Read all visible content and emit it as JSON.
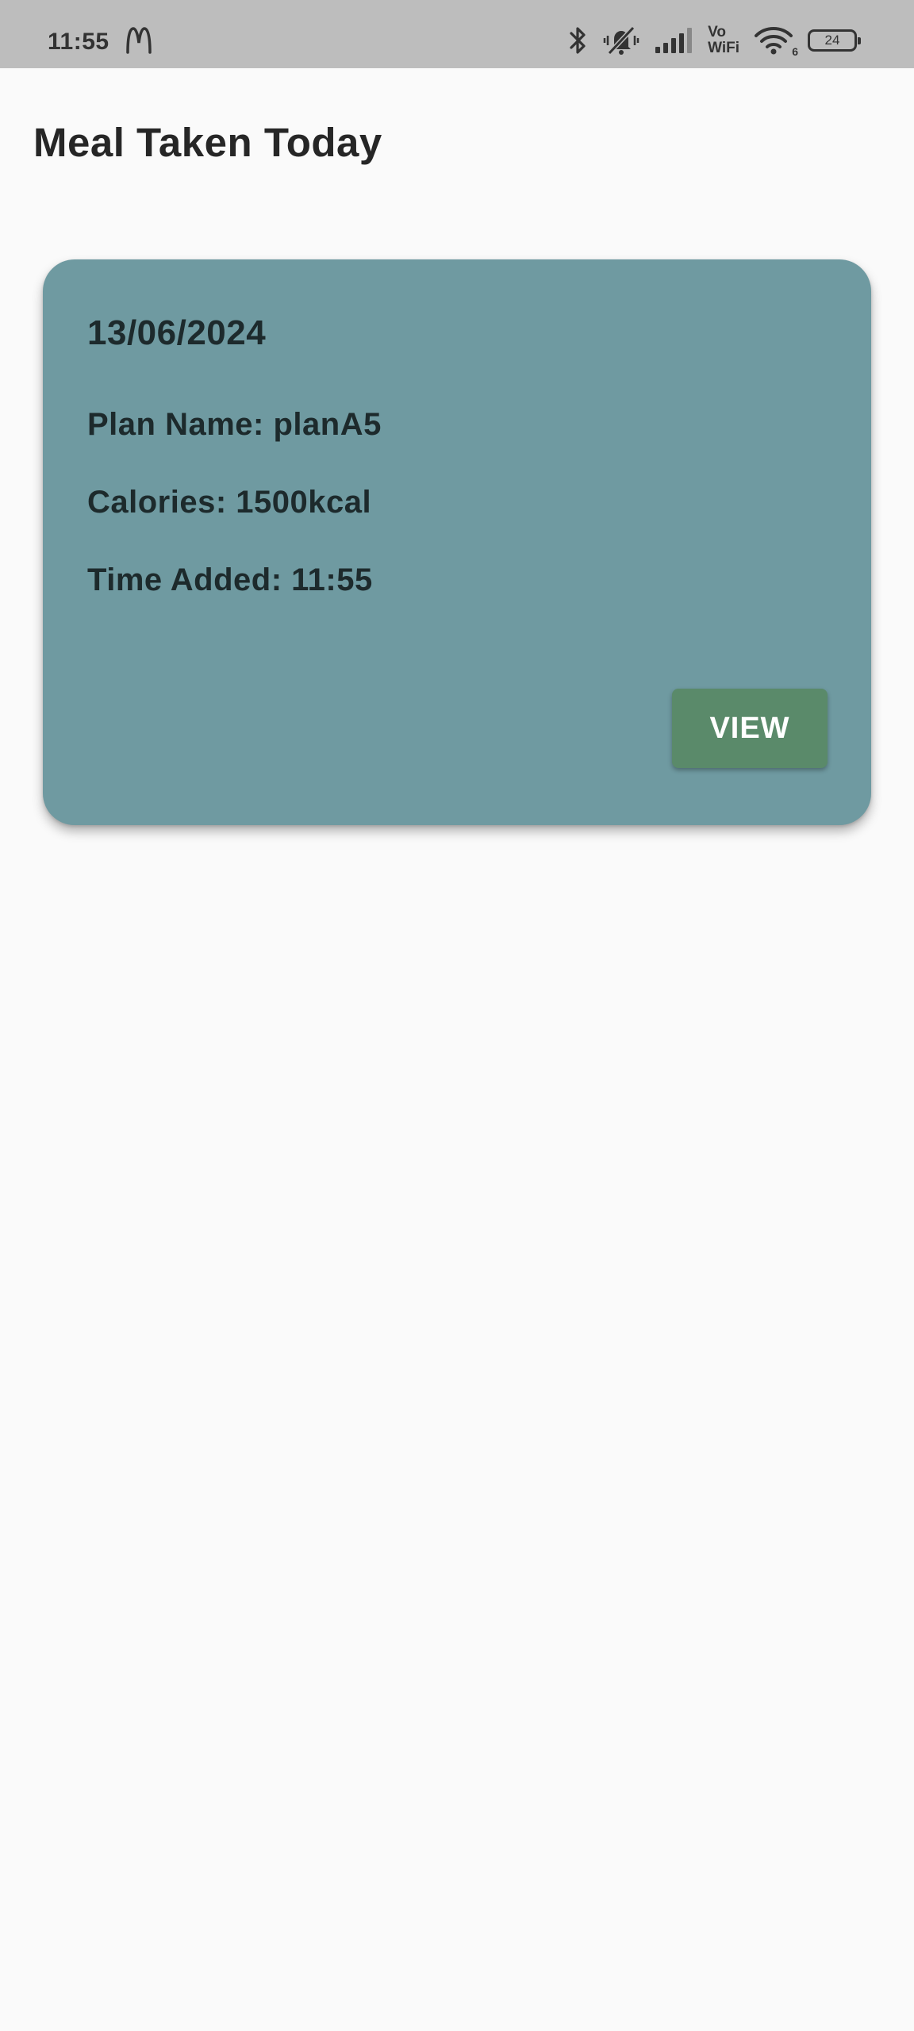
{
  "status_bar": {
    "time": "11:55",
    "vowifi_top": "Vo",
    "vowifi_bottom": "WiFi",
    "wifi_label": "6",
    "battery": "24"
  },
  "header": {
    "title": "Meal Taken Today"
  },
  "meals": [
    {
      "date": "13/06/2024",
      "plan": "Plan Name: planA5",
      "calories": "Calories: 1500kcal",
      "time_added": "Time Added: 11:55",
      "view_label": "VIEW"
    }
  ],
  "colors": {
    "status_bar_bg": "#bdbdbd",
    "page_bg": "#fafafa",
    "card_bg": "#6f9aa1",
    "button_bg": "#5a8a6a",
    "button_text": "#ffffff"
  }
}
